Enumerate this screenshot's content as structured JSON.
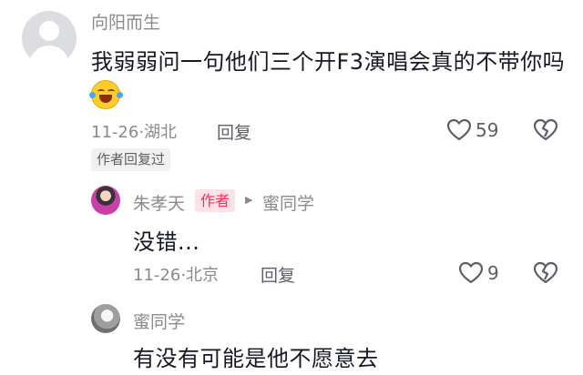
{
  "comment": {
    "username": "向阳而生",
    "text": "我弱弱问一句他们三个开F3演唱会真的不带你吗",
    "emoji": "laughing-with-tears-emoji",
    "date": "11-26",
    "location": "湖北",
    "reply_label": "回复",
    "like_count": "59",
    "author_replied_tag": "作者回复过"
  },
  "replies": [
    {
      "username": "朱孝天",
      "badge": "作者",
      "reply_to": "蜜同学",
      "text": "没错...",
      "date": "11-26",
      "location": "北京",
      "reply_label": "回复",
      "like_count": "9"
    },
    {
      "username": "蜜同学",
      "text": "有没有可能是他不愿意去"
    }
  ],
  "separators": {
    "dot": "·",
    "arrow": "▶"
  },
  "colors": {
    "text_primary": "#161823",
    "text_secondary": "#8a8a8f",
    "author_badge": "#fe2c55",
    "author_badge_bg": "#fde3e8"
  }
}
